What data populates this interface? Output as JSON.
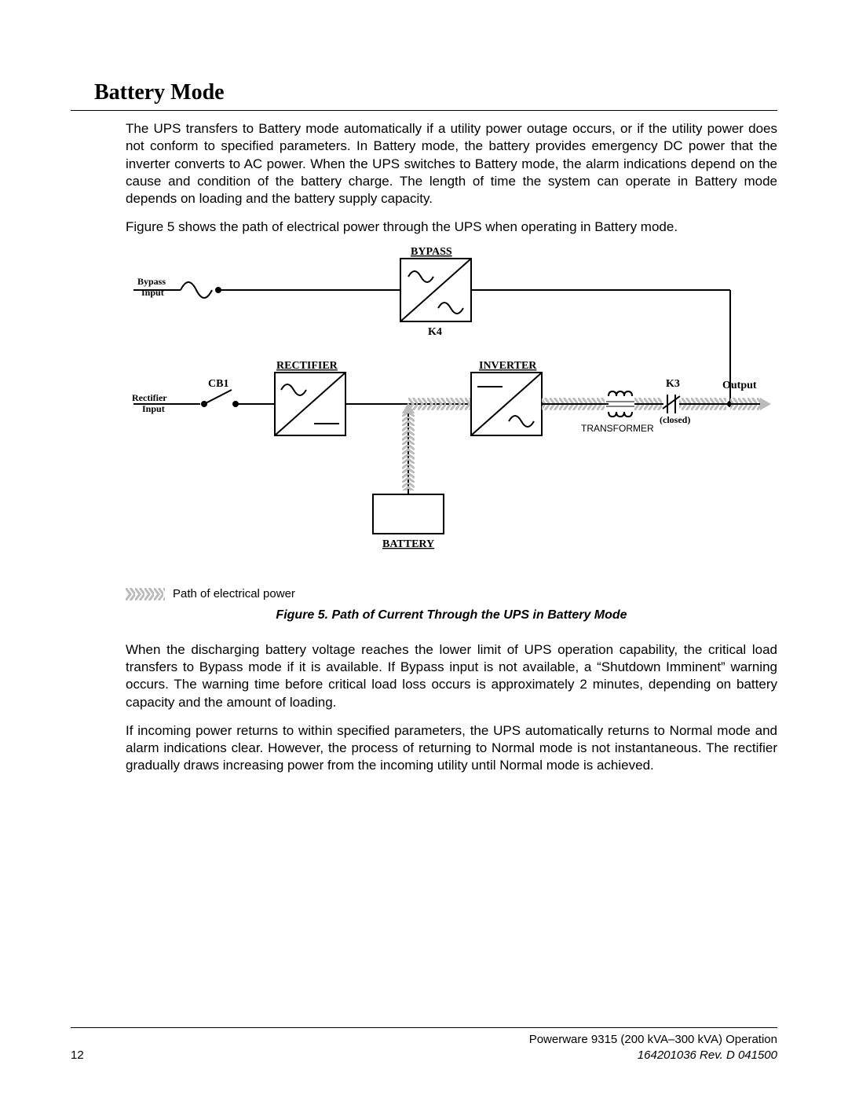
{
  "section_title": "Battery Mode",
  "para1": "The UPS transfers to Battery mode automatically if a utility power outage occurs, or if the utility power does not conform to specified parameters.  In Battery mode, the battery provides emergency DC power that the inverter converts to AC power.  When the UPS switches to Battery mode, the alarm indications depend on the cause and condition of the battery charge.  The length of time the system can operate in Battery mode depends on loading and the battery supply capacity.",
  "para2": "Figure 5 shows the path of electrical power through the UPS when  operating in Battery mode.",
  "legend": "Path of electrical power",
  "figure_caption": "Figure 5.  Path of Current Through the UPS in Battery Mode",
  "para3": "When the discharging battery voltage reaches the lower limit of UPS operation capability, the critical load transfers to Bypass mode if it is available.  If Bypass input is not available, a “Shutdown Imminent” warning occurs.  The warning time before critical load loss occurs is approximately 2 minutes, depending on battery capacity and the amount of loading.",
  "para4": "If incoming power returns to within specified parameters, the UPS automatically returns to Normal mode and alarm indications clear.  However, the process of returning to Normal mode is not instantaneous.  The rectifier gradually draws increasing power from the incoming utility until Normal mode is achieved.",
  "labels": {
    "bypass": "BYPASS",
    "rectifier": "RECTIFIER",
    "inverter": "INVERTER",
    "battery": "BATTERY",
    "cb1": "CB1",
    "k3": "K3",
    "k4": "K4",
    "output": "Output",
    "transformer": "TRANSFORMER",
    "closed": "(closed)",
    "bypass_input1": "Bypass",
    "bypass_input2": "Input",
    "rect_input1": "Rectifier",
    "rect_input2": "Input"
  },
  "footer": {
    "page_no": "12",
    "line1": "Powerware 9315 (200 kVA–300 kVA) Operation",
    "line2": "164201036  Rev. D  041500"
  }
}
